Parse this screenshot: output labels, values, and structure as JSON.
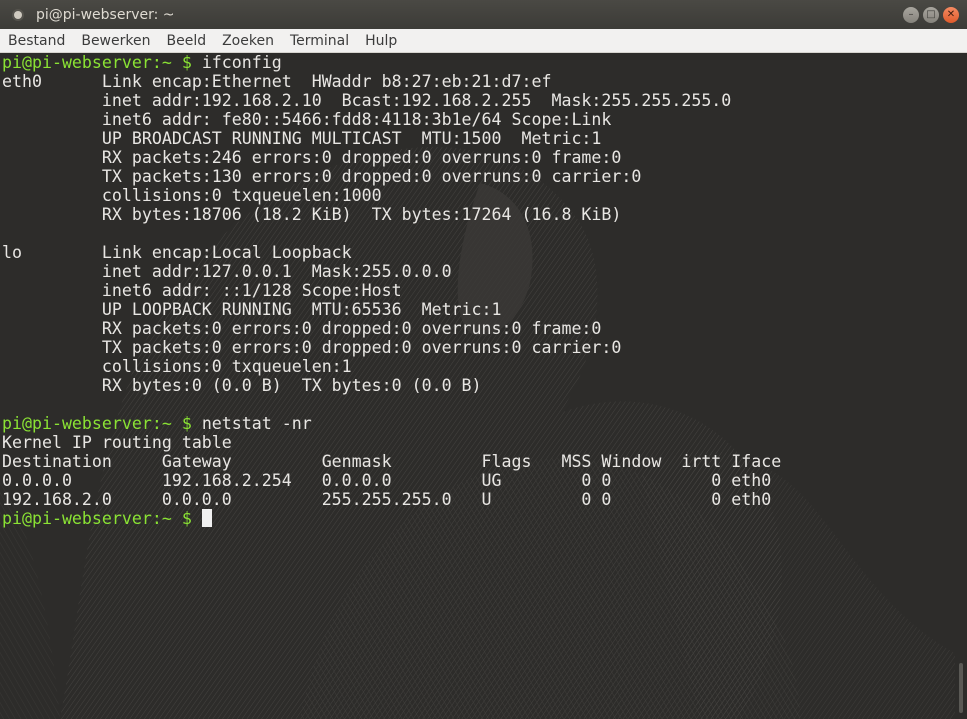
{
  "window": {
    "title": "pi@pi-webserver: ~"
  },
  "menu": [
    "Bestand",
    "Bewerken",
    "Beeld",
    "Zoeken",
    "Terminal",
    "Hulp"
  ],
  "terminal": {
    "prompt": "pi@pi-webserver:~ $ ",
    "cmd1": "ifconfig",
    "ifconfig": [
      "eth0      Link encap:Ethernet  HWaddr b8:27:eb:21:d7:ef",
      "          inet addr:192.168.2.10  Bcast:192.168.2.255  Mask:255.255.255.0",
      "          inet6 addr: fe80::5466:fdd8:4118:3b1e/64 Scope:Link",
      "          UP BROADCAST RUNNING MULTICAST  MTU:1500  Metric:1",
      "          RX packets:246 errors:0 dropped:0 overruns:0 frame:0",
      "          TX packets:130 errors:0 dropped:0 overruns:0 carrier:0",
      "          collisions:0 txqueuelen:1000",
      "          RX bytes:18706 (18.2 KiB)  TX bytes:17264 (16.8 KiB)",
      "",
      "lo        Link encap:Local Loopback",
      "          inet addr:127.0.0.1  Mask:255.0.0.0",
      "          inet6 addr: ::1/128 Scope:Host",
      "          UP LOOPBACK RUNNING  MTU:65536  Metric:1",
      "          RX packets:0 errors:0 dropped:0 overruns:0 frame:0",
      "          TX packets:0 errors:0 dropped:0 overruns:0 carrier:0",
      "          collisions:0 txqueuelen:1",
      "          RX bytes:0 (0.0 B)  TX bytes:0 (0.0 B)",
      ""
    ],
    "cmd2": "netstat -nr",
    "netstat": [
      "Kernel IP routing table",
      "Destination     Gateway         Genmask         Flags   MSS Window  irtt Iface",
      "0.0.0.0         192.168.2.254   0.0.0.0         UG        0 0          0 eth0",
      "192.168.2.0     0.0.0.0         255.255.255.0   U         0 0          0 eth0"
    ]
  },
  "colors": {
    "prompt": "#8ae234",
    "text": "#e8e6e3",
    "background": "#2d2c2a",
    "close": "#e05a2b"
  }
}
